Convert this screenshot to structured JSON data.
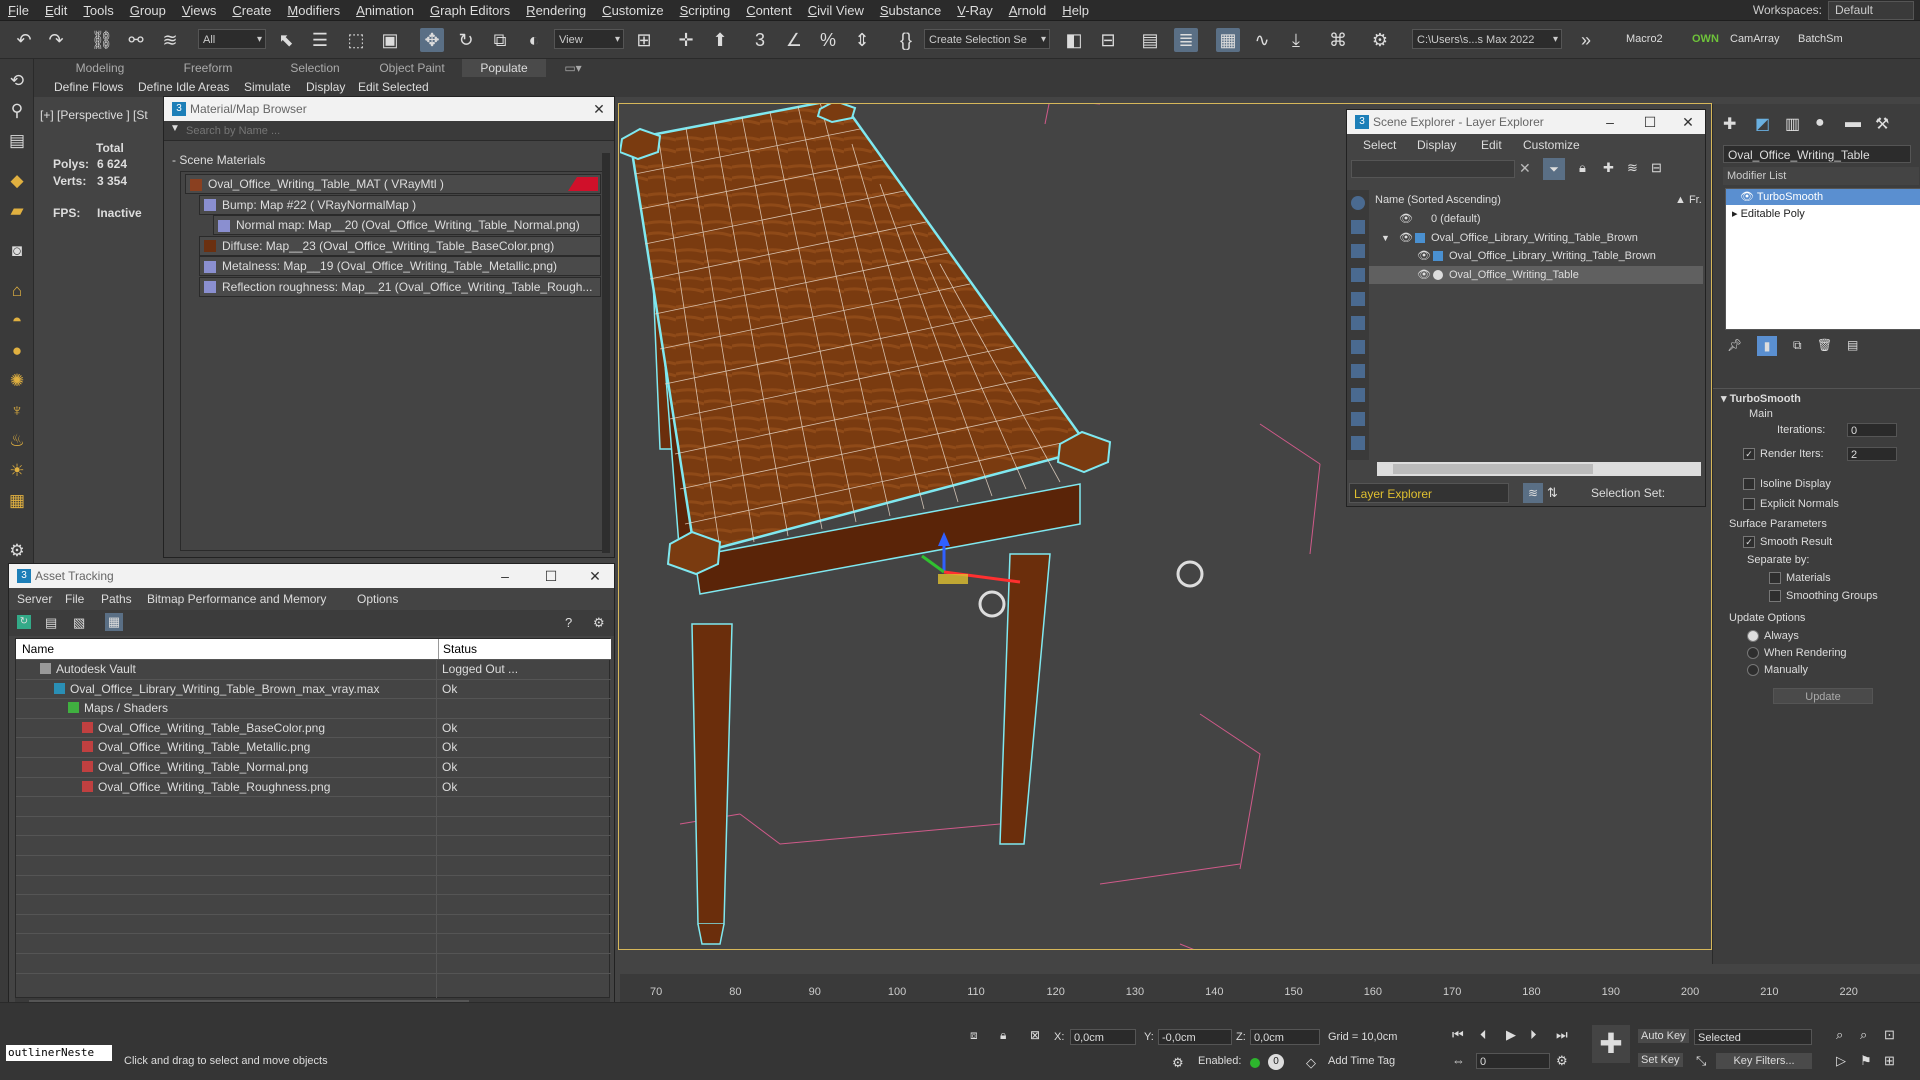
{
  "menu": [
    "File",
    "Edit",
    "Tools",
    "Group",
    "Views",
    "Create",
    "Modifiers",
    "Animation",
    "Graph Editors",
    "Rendering",
    "Customize",
    "Scripting",
    "Content",
    "Civil View",
    "Substance",
    "V-Ray",
    "Arnold",
    "Help"
  ],
  "workspaces": {
    "label": "Workspaces:",
    "value": "Default"
  },
  "toolbar": {
    "filter": "All",
    "view": "View",
    "selection_set": "Create Selection Se",
    "path": "C:\\Users\\s...s Max 2022",
    "macro": "Macro2",
    "own": "OWN",
    "camarray": "CamArray",
    "batch": "BatchSm"
  },
  "ribbon": {
    "tabs": [
      "Modeling",
      "Freeform",
      "Selection",
      "Object Paint",
      "Populate"
    ],
    "sub": [
      "Define Flows",
      "Define Idle Areas",
      "Simulate",
      "Display",
      "Edit Selected"
    ]
  },
  "viewport": {
    "label": "[+] [Perspective ] [St",
    "stats": {
      "total_label": "Total",
      "polys_label": "Polys:",
      "polys": "6 624",
      "verts_label": "Verts:",
      "verts": "3 354",
      "fps_label": "FPS:",
      "fps": "Inactive"
    }
  },
  "material_browser": {
    "title": "Material/Map Browser",
    "search": "Search by Name ...",
    "section": "- Scene Materials",
    "items": [
      {
        "label": "Oval_Office_Writing_Table_MAT  ( VRayMtl )",
        "indent": 0
      },
      {
        "label": "Bump: Map #22  ( VRayNormalMap )",
        "indent": 1
      },
      {
        "label": "Normal map: Map__20 (Oval_Office_Writing_Table_Normal.png)",
        "indent": 2
      },
      {
        "label": "Diffuse: Map__23 (Oval_Office_Writing_Table_BaseColor.png)",
        "indent": 1
      },
      {
        "label": "Metalness: Map__19 (Oval_Office_Writing_Table_Metallic.png)",
        "indent": 1
      },
      {
        "label": "Reflection roughness: Map__21 (Oval_Office_Writing_Table_Rough...",
        "indent": 1
      }
    ]
  },
  "asset_tracking": {
    "title": "Asset Tracking",
    "menu": [
      "Server",
      "File",
      "Paths",
      "Bitmap Performance and Memory",
      "Options"
    ],
    "columns": [
      "Name",
      "Status"
    ],
    "rows": [
      {
        "name": "Autodesk Vault",
        "status": "Logged Out ...",
        "indent": 0
      },
      {
        "name": "Oval_Office_Library_Writing_Table_Brown_max_vray.max",
        "status": "Ok",
        "indent": 1
      },
      {
        "name": "Maps / Shaders",
        "status": "",
        "indent": 2
      },
      {
        "name": "Oval_Office_Writing_Table_BaseColor.png",
        "status": "Ok",
        "indent": 3
      },
      {
        "name": "Oval_Office_Writing_Table_Metallic.png",
        "status": "Ok",
        "indent": 3
      },
      {
        "name": "Oval_Office_Writing_Table_Normal.png",
        "status": "Ok",
        "indent": 3
      },
      {
        "name": "Oval_Office_Writing_Table_Roughness.png",
        "status": "Ok",
        "indent": 3
      }
    ]
  },
  "scene_explorer": {
    "title": "Scene Explorer - Layer Explorer",
    "menu": [
      "Select",
      "Display",
      "Edit",
      "Customize"
    ],
    "col_name": "Name (Sorted Ascending)",
    "col_fr": "▲ Fr.",
    "items": [
      {
        "label": "0 (default)",
        "indent": 0
      },
      {
        "label": "Oval_Office_Library_Writing_Table_Brown",
        "indent": 0
      },
      {
        "label": "Oval_Office_Library_Writing_Table_Brown",
        "indent": 1
      },
      {
        "label": "Oval_Office_Writing_Table",
        "indent": 1
      }
    ],
    "footer_dropdown": "Layer Explorer",
    "selection_set": "Selection Set:"
  },
  "modifier_panel": {
    "object_name": "Oval_Office_Writing_Table",
    "modifier_list": "Modifier List",
    "stack": [
      "TurboSmooth",
      "Editable Poly"
    ],
    "rollout_title": "TurboSmooth",
    "main": "Main",
    "iterations_label": "Iterations:",
    "iterations": "0",
    "render_iters_label": "Render Iters:",
    "render_iters": "2",
    "isoline": "Isoline Display",
    "explicit_normals": "Explicit Normals",
    "surface_params": "Surface Parameters",
    "smooth_result": "Smooth Result",
    "separate_by": "Separate by:",
    "materials": "Materials",
    "smoothing_groups": "Smoothing Groups",
    "update_options": "Update Options",
    "always": "Always",
    "when_rendering": "When Rendering",
    "manually": "Manually",
    "update": "Update"
  },
  "timeline": {
    "ticks": [
      "70",
      "80",
      "90",
      "100",
      "110",
      "120",
      "130",
      "140",
      "150",
      "160",
      "170",
      "180",
      "190",
      "200",
      "210",
      "220"
    ]
  },
  "status": {
    "listener": "outlinerNeste",
    "prompt": "Click and drag to select and move objects",
    "x_label": "X:",
    "x": "0,0cm",
    "y_label": "Y:",
    "y": "-0,0cm",
    "z_label": "Z:",
    "z": "0,0cm",
    "grid": "Grid = 10,0cm",
    "enabled": "Enabled:",
    "add_time_tag": "Add Time Tag",
    "auto_key": "Auto Key",
    "selected": "Selected",
    "set_key": "Set Key",
    "key_filters": "Key Filters...",
    "frame": "0"
  }
}
